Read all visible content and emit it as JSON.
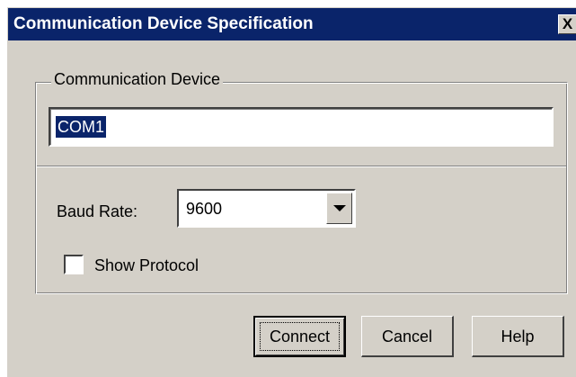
{
  "window": {
    "title": "Communication Device Specification",
    "close_label": "X"
  },
  "device_group": {
    "label": "Communication Device",
    "device_value": "COM1"
  },
  "settings": {
    "baud_label": "Baud Rate:",
    "baud_value": "9600",
    "show_protocol_label": "Show Protocol",
    "show_protocol_checked": false
  },
  "buttons": {
    "connect": "Connect",
    "cancel": "Cancel",
    "help": "Help"
  },
  "colors": {
    "titlebar": "#0a246a",
    "face": "#d4d0c8",
    "selection": "#0a246a"
  }
}
